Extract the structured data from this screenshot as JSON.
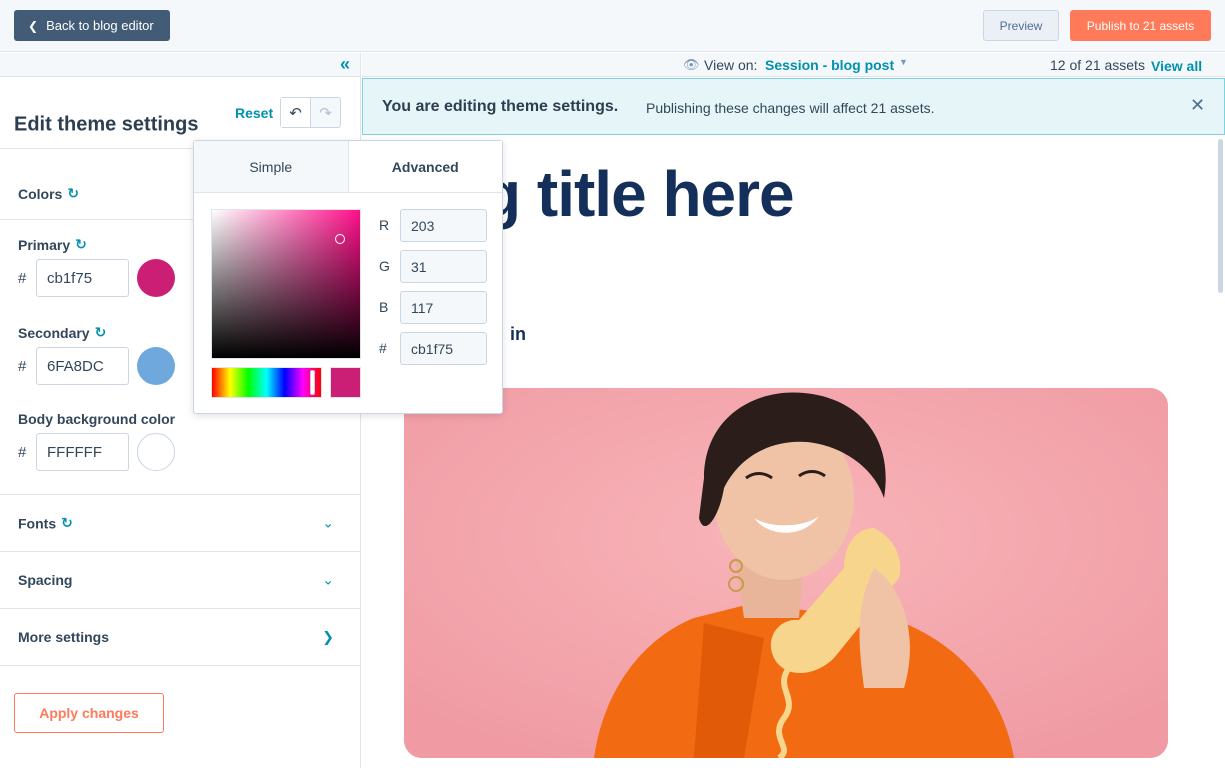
{
  "topbar": {
    "back_label": "Back to blog editor",
    "preview_label": "Preview",
    "publish_label": "Publish to 21 assets"
  },
  "panel": {
    "title": "Edit theme settings",
    "reset_label": "Reset",
    "sections": {
      "colors": "Colors",
      "fonts": "Fonts",
      "spacing": "Spacing",
      "more": "More settings"
    },
    "primary": {
      "label": "Primary",
      "hash": "#",
      "value": "cb1f75",
      "color": "#cb1f75"
    },
    "secondary": {
      "label": "Secondary",
      "hash": "#",
      "value": "6FA8DC",
      "color": "#6fa8dc"
    },
    "body_bg": {
      "label": "Body background color",
      "hash": "#",
      "value": "FFFFFF",
      "color": "#ffffff"
    },
    "apply_label": "Apply changes"
  },
  "viewbar": {
    "view_on_label": "View on:",
    "session_label": "Session - blog post",
    "asset_count": "12 of 21 assets",
    "view_all_label": "View all"
  },
  "notice": {
    "title": "You are editing theme settings.",
    "text": "Publishing these changes will affect 21 assets."
  },
  "preview": {
    "title_fragment": "g title here",
    "social_fragment": "in"
  },
  "picker": {
    "tab_simple": "Simple",
    "tab_advanced": "Advanced",
    "r_label": "R",
    "r_value": "203",
    "g_label": "G",
    "g_value": "31",
    "b_label": "B",
    "b_value": "117",
    "hex_label": "#",
    "hex_value": "cb1f75",
    "selected_color": "#cb1f75"
  },
  "colors": {
    "accent": "#0091ae",
    "publish": "#ff7a59",
    "dark_button": "#425b76"
  }
}
